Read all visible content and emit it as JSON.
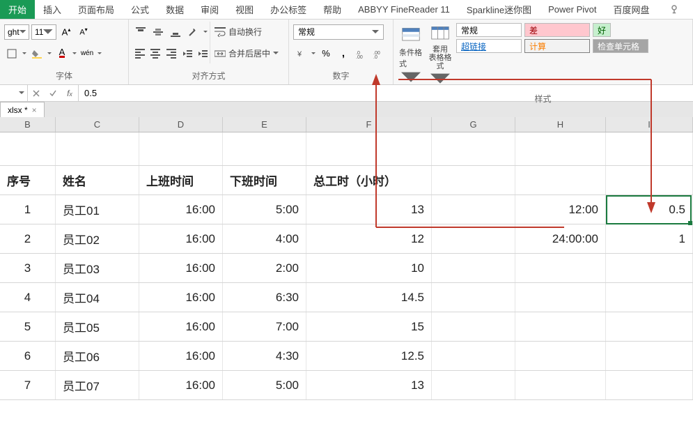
{
  "tabs": [
    "开始",
    "插入",
    "页面布局",
    "公式",
    "数据",
    "审阅",
    "视图",
    "办公标签",
    "帮助",
    "ABBYY FineReader 11",
    "Sparkline迷你图",
    "Power Pivot",
    "百度网盘"
  ],
  "ribbon": {
    "font": {
      "name_value": "ght",
      "size_value": "11",
      "group_label": "字体"
    },
    "align": {
      "wrap_label": "自动换行",
      "merge_label": "合并后居中",
      "group_label": "对齐方式"
    },
    "number": {
      "format_value": "常规",
      "group_label": "数字"
    },
    "styles": {
      "cond_label": "条件格式",
      "table_label": "套用\n表格格式",
      "link_label": "超链接",
      "normal": "常规",
      "bad": "差",
      "good": "好",
      "calc": "计算",
      "check": "检查单元格",
      "group_label": "样式"
    }
  },
  "formula_bar": {
    "value": "0.5"
  },
  "workbook_tab": {
    "name": "xlsx *"
  },
  "columns": [
    "B",
    "C",
    "D",
    "E",
    "F",
    "G",
    "H",
    "I"
  ],
  "headers": {
    "b": "序号",
    "c": "姓名",
    "d": "上班时间",
    "e": "下班时间",
    "f": "总工时（小时）"
  },
  "rows": [
    {
      "b": "1",
      "c": "员工01",
      "d": "16:00",
      "e": "5:00",
      "f": "13",
      "g": "",
      "h": "12:00",
      "i": "0.5"
    },
    {
      "b": "2",
      "c": "员工02",
      "d": "16:00",
      "e": "4:00",
      "f": "12",
      "g": "",
      "h": "24:00:00",
      "i": "1"
    },
    {
      "b": "3",
      "c": "员工03",
      "d": "16:00",
      "e": "2:00",
      "f": "10",
      "g": "",
      "h": "",
      "i": ""
    },
    {
      "b": "4",
      "c": "员工04",
      "d": "16:00",
      "e": "6:30",
      "f": "14.5",
      "g": "",
      "h": "",
      "i": ""
    },
    {
      "b": "5",
      "c": "员工05",
      "d": "16:00",
      "e": "7:00",
      "f": "15",
      "g": "",
      "h": "",
      "i": ""
    },
    {
      "b": "6",
      "c": "员工06",
      "d": "16:00",
      "e": "4:30",
      "f": "12.5",
      "g": "",
      "h": "",
      "i": ""
    },
    {
      "b": "7",
      "c": "员工07",
      "d": "16:00",
      "e": "5:00",
      "f": "13",
      "g": "",
      "h": "",
      "i": ""
    }
  ]
}
